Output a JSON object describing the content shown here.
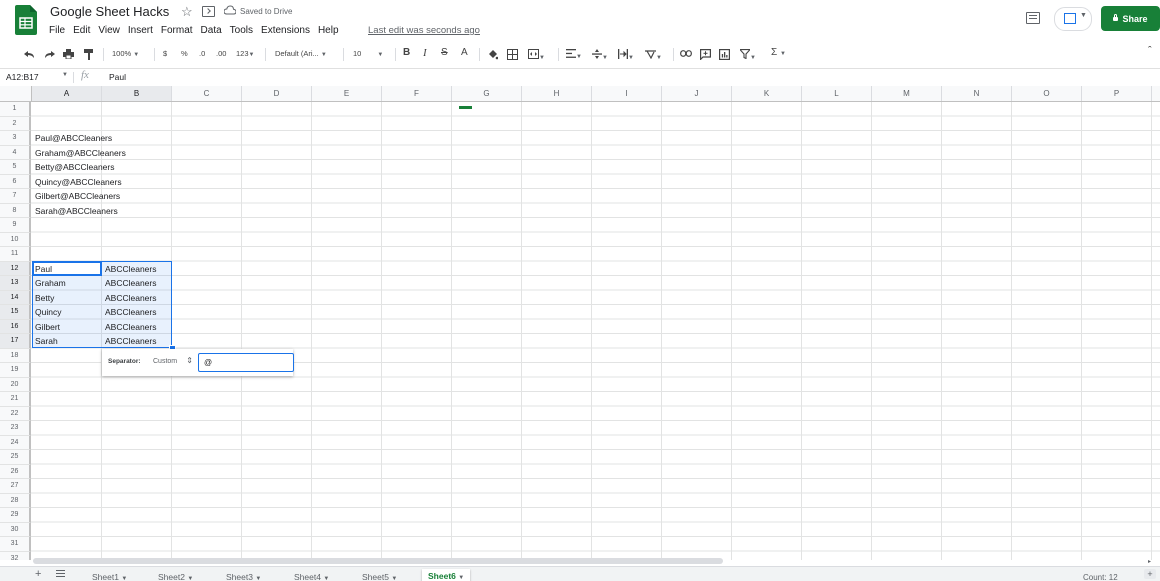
{
  "doc": {
    "title": "Google Sheet Hacks",
    "saved_status": "Saved to Drive",
    "last_edit": "Last edit was seconds ago",
    "share_label": "Share"
  },
  "menu": [
    "File",
    "Edit",
    "View",
    "Insert",
    "Format",
    "Data",
    "Tools",
    "Extensions",
    "Help"
  ],
  "toolbar": {
    "zoom": "100%",
    "currency": "$",
    "percent": "%",
    "dec_decrease": ".0",
    "dec_increase": ".00",
    "more_formats": "123",
    "font": "Default (Ari...",
    "font_size": "10",
    "bold": "B",
    "italic": "I",
    "strike": "S",
    "text_color": "A",
    "sum": "Σ"
  },
  "formula_bar": {
    "name_box": "A12:B17",
    "fx": "fx",
    "value": "Paul"
  },
  "columns": [
    "A",
    "B",
    "C",
    "D",
    "E",
    "F",
    "G",
    "H",
    "I",
    "J",
    "K",
    "L",
    "M",
    "N",
    "O",
    "P"
  ],
  "rows": [
    "1",
    "2",
    "3",
    "4",
    "5",
    "6",
    "7",
    "8",
    "9",
    "10",
    "11",
    "12",
    "13",
    "14",
    "15",
    "16",
    "17",
    "18",
    "19",
    "20",
    "21",
    "22",
    "23",
    "24",
    "25",
    "26",
    "27",
    "28",
    "29",
    "30",
    "31",
    "32"
  ],
  "cells": {
    "emails": [
      "Paul@ABCCleaners",
      "Graham@ABCCleaners",
      "Betty@ABCCleaners",
      "Quincy@ABCCleaners",
      "Gilbert@ABCCleaners",
      "Sarah@ABCCleaners"
    ],
    "names": [
      "Paul",
      "Graham",
      "Betty",
      "Quincy",
      "Gilbert",
      "Sarah"
    ],
    "companies": [
      "ABCCleaners",
      "ABCCleaners",
      "ABCCleaners",
      "ABCCleaners",
      "ABCCleaners",
      "ABCCleaners"
    ]
  },
  "separator_popup": {
    "label": "Separator:",
    "option": "Custom",
    "value": "@"
  },
  "sheets": {
    "tabs": [
      "Sheet1",
      "Sheet2",
      "Sheet3",
      "Sheet4",
      "Sheet5",
      "Sheet6"
    ],
    "active": "Sheet6",
    "count_label": "Count: 12"
  },
  "colors": {
    "accent": "#1a73e8",
    "brand_green": "#188038"
  }
}
